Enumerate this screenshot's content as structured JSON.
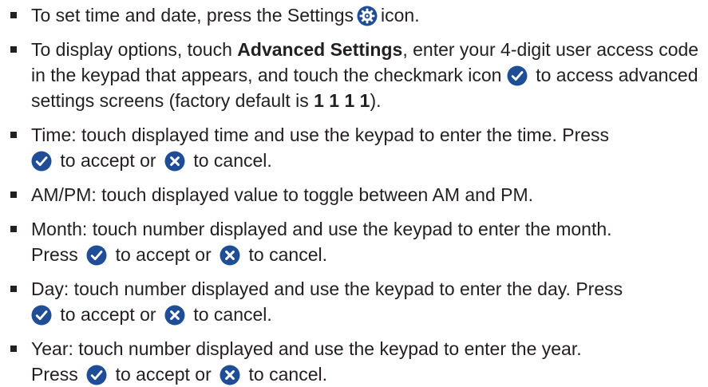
{
  "colors": {
    "icon_blue": "#1f4e96",
    "text": "#231f20"
  },
  "icons": {
    "settings": "gear-icon",
    "accept": "checkmark-icon",
    "cancel": "x-cancel-icon"
  },
  "items": [
    {
      "a": "To set time and date, press the Settings",
      "b": "icon."
    },
    {
      "a": "To display options, touch",
      "bold": "Advanced Settings",
      "b": ", enter your 4-digit user access code in the keypad that appears, and touch the checkmark icon",
      "c": "to access advanced settings screens (factory default is",
      "code": "1 1 1 1",
      "d": ")."
    },
    {
      "a": "Time: touch displayed time and use the keypad to enter the time. Press",
      "b": "to accept or",
      "c": "to cancel."
    },
    {
      "a": "AM/PM: touch displayed value to toggle between AM and PM."
    },
    {
      "a": "Month: touch number displayed and use the keypad to enter the month.",
      "press": "Press",
      "b": "to accept or",
      "c": "to cancel."
    },
    {
      "a": "Day: touch number displayed and use the keypad to enter the day. Press",
      "b": "to accept or",
      "c": "to cancel."
    },
    {
      "a": "Year: touch number displayed and use the keypad to enter the year.",
      "press": "Press",
      "b": "to accept or",
      "c": "to cancel."
    }
  ]
}
